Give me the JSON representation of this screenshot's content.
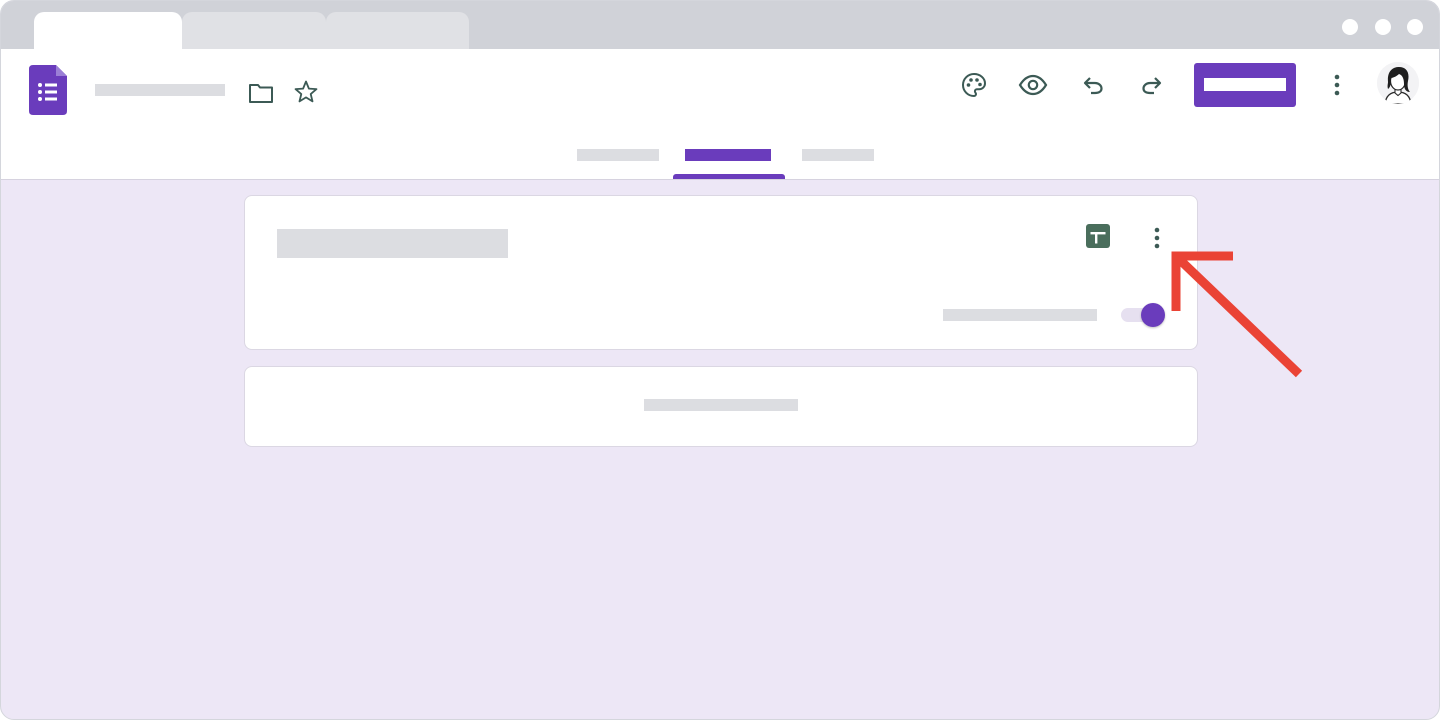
{
  "colors": {
    "accent": "#6a3cbc",
    "background": "#ede7f6",
    "placeholder": "#dcdde1",
    "icon": "#3c5a55",
    "sheets": "#4a6e5c",
    "annotation_arrow": "#ea4335"
  },
  "browser": {
    "tabs": [
      "",
      "",
      ""
    ],
    "window_controls": [
      "dot",
      "dot",
      "dot"
    ]
  },
  "header": {
    "app_icon": "google-forms-icon",
    "title": "",
    "icons": [
      "folder-icon",
      "star-icon",
      "palette-icon",
      "eye-icon",
      "undo-icon",
      "redo-icon",
      "more-vert-icon"
    ],
    "send_label": "",
    "avatar": "avatar-icon"
  },
  "nav": {
    "tabs": [
      "",
      "",
      ""
    ],
    "active_tab_index": 1
  },
  "responses_card": {
    "title": "",
    "sheets_icon": "sheets-icon",
    "menu_icon": "more-vert-icon",
    "accepting_label": "",
    "accepting_toggle_on": true
  },
  "summary_card": {
    "label": ""
  },
  "annotation": {
    "type": "arrow",
    "points_to": "responses-menu-button"
  }
}
